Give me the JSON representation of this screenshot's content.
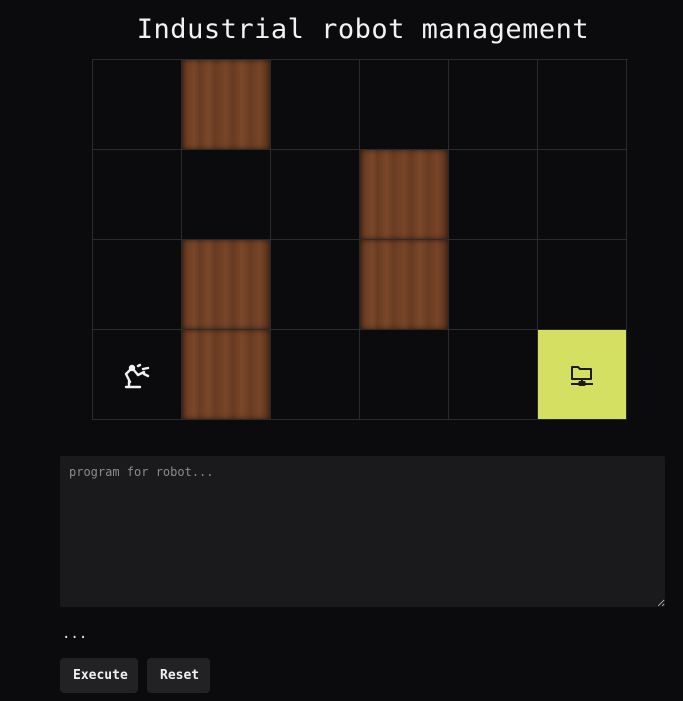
{
  "title": "Industrial robot management",
  "grid": {
    "rows": 4,
    "cols": 6,
    "cells": [
      [
        "empty",
        "wood",
        "empty",
        "empty",
        "empty",
        "empty"
      ],
      [
        "empty",
        "empty",
        "empty",
        "wood",
        "empty",
        "empty"
      ],
      [
        "empty",
        "wood",
        "empty",
        "wood",
        "empty",
        "empty"
      ],
      [
        "robot",
        "wood",
        "empty",
        "empty",
        "empty",
        "goal"
      ]
    ],
    "robot_icon": "robot-arm-icon",
    "goal_icon": "network-folder-icon"
  },
  "colors": {
    "background": "#0b0b0d",
    "wood": "#6f3f24",
    "goal": "#d4e062",
    "editor_bg": "#1a1a1c",
    "button_bg": "#222225"
  },
  "editor": {
    "placeholder": "program for robot...",
    "value": ""
  },
  "status": {
    "text": "..."
  },
  "buttons": {
    "execute_label": "Execute",
    "reset_label": "Reset"
  }
}
